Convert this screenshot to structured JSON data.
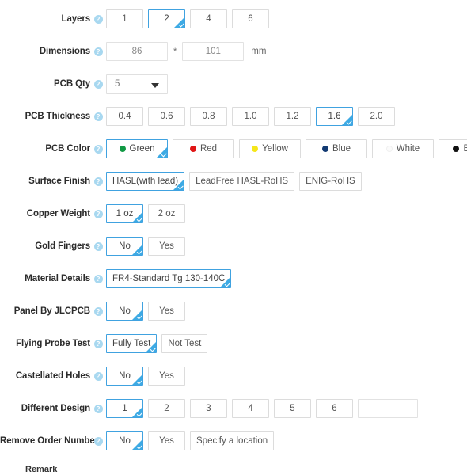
{
  "form": {
    "help_icon_glyph": "?",
    "rows": [
      {
        "id": "layers",
        "label": "Layers",
        "type": "options",
        "options": [
          {
            "label": "1",
            "selected": false
          },
          {
            "label": "2",
            "selected": true
          },
          {
            "label": "4",
            "selected": false
          },
          {
            "label": "6",
            "selected": false
          }
        ]
      },
      {
        "id": "dimensions",
        "label": "Dimensions",
        "type": "dimensions",
        "width_value": "86",
        "height_value": "101",
        "separator": "*",
        "unit": "mm"
      },
      {
        "id": "pcb-qty",
        "label": "PCB Qty",
        "type": "select",
        "value": "5"
      },
      {
        "id": "pcb-thickness",
        "label": "PCB Thickness",
        "type": "options",
        "options": [
          {
            "label": "0.4",
            "selected": false
          },
          {
            "label": "0.6",
            "selected": false
          },
          {
            "label": "0.8",
            "selected": false
          },
          {
            "label": "1.0",
            "selected": false
          },
          {
            "label": "1.2",
            "selected": false
          },
          {
            "label": "1.6",
            "selected": true
          },
          {
            "label": "2.0",
            "selected": false
          }
        ]
      },
      {
        "id": "pcb-color",
        "label": "PCB Color",
        "type": "colors",
        "options": [
          {
            "label": "Green",
            "selected": true,
            "swatch": "green",
            "hex": "#119944"
          },
          {
            "label": "Red",
            "selected": false,
            "swatch": "red",
            "hex": "#e01616"
          },
          {
            "label": "Yellow",
            "selected": false,
            "swatch": "yellow",
            "hex": "#f5e61a"
          },
          {
            "label": "Blue",
            "selected": false,
            "swatch": "blue",
            "hex": "#123a72"
          },
          {
            "label": "White",
            "selected": false,
            "swatch": "white",
            "hex": "#fbfbfb"
          },
          {
            "label": "Black",
            "selected": false,
            "swatch": "black",
            "hex": "#111111"
          }
        ]
      },
      {
        "id": "surface-finish",
        "label": "Surface Finish",
        "type": "options",
        "options": [
          {
            "label": "HASL(with lead)",
            "selected": true
          },
          {
            "label": "LeadFree HASL-RoHS",
            "selected": false
          },
          {
            "label": "ENIG-RoHS",
            "selected": false
          }
        ]
      },
      {
        "id": "copper-weight",
        "label": "Copper Weight",
        "type": "options",
        "options": [
          {
            "label": "1 oz",
            "selected": true
          },
          {
            "label": "2 oz",
            "selected": false
          }
        ]
      },
      {
        "id": "gold-fingers",
        "label": "Gold Fingers",
        "type": "options",
        "options": [
          {
            "label": "No",
            "selected": true
          },
          {
            "label": "Yes",
            "selected": false
          }
        ]
      },
      {
        "id": "material-details",
        "label": "Material Details",
        "type": "options",
        "options": [
          {
            "label": "FR4-Standard Tg 130-140C",
            "selected": true
          }
        ]
      },
      {
        "id": "panel-by-jlcpcb",
        "label": "Panel By JLCPCB",
        "type": "options",
        "options": [
          {
            "label": "No",
            "selected": true
          },
          {
            "label": "Yes",
            "selected": false
          }
        ]
      },
      {
        "id": "flying-probe-test",
        "label": "Flying Probe Test",
        "type": "options",
        "options": [
          {
            "label": "Fully Test",
            "selected": true
          },
          {
            "label": "Not Test",
            "selected": false
          }
        ]
      },
      {
        "id": "castellated-holes",
        "label": "Castellated Holes",
        "type": "options",
        "options": [
          {
            "label": "No",
            "selected": true
          },
          {
            "label": "Yes",
            "selected": false
          }
        ]
      },
      {
        "id": "different-design",
        "label": "Different Design",
        "type": "options-with-input",
        "options": [
          {
            "label": "1",
            "selected": true
          },
          {
            "label": "2",
            "selected": false
          },
          {
            "label": "3",
            "selected": false
          },
          {
            "label": "4",
            "selected": false
          },
          {
            "label": "5",
            "selected": false
          },
          {
            "label": "6",
            "selected": false
          }
        ],
        "input_value": "",
        "input_placeholder": ""
      },
      {
        "id": "remove-order-number",
        "label": "Remove Order Number",
        "type": "options",
        "options": [
          {
            "label": "No",
            "selected": true
          },
          {
            "label": "Yes",
            "selected": false
          },
          {
            "label": "Specify a location",
            "selected": false
          }
        ]
      }
    ],
    "remark": {
      "label": "Remark"
    },
    "colors": {
      "selected_border": "#40a2e0",
      "selected_corner": "#3daae4",
      "help_icon": "#a8d8f0",
      "option_border": "#dcdcdc",
      "label_text": "#2b2b2b"
    }
  }
}
